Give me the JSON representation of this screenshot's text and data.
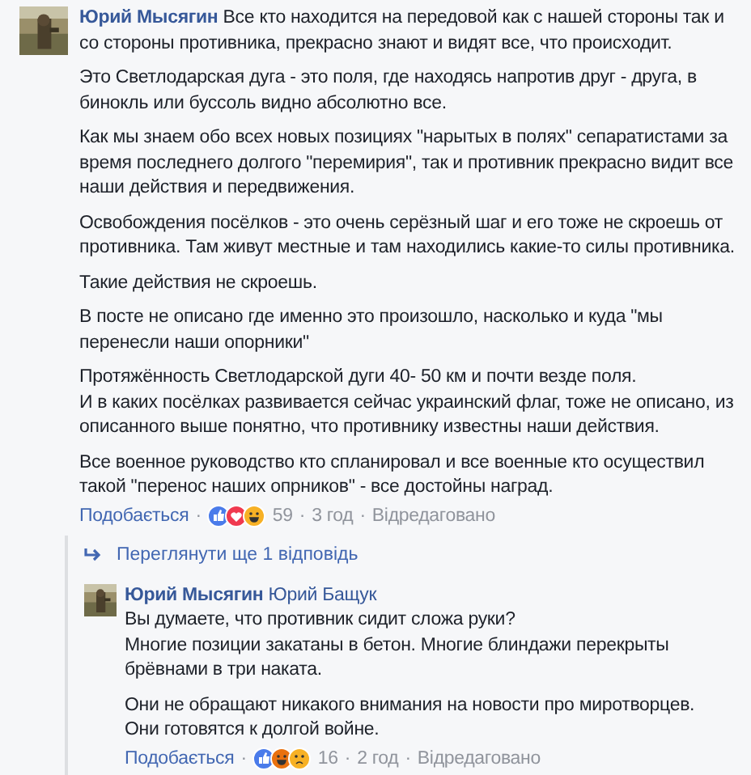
{
  "comment": {
    "author": "Юрий Мысягин",
    "paragraphs": [
      "Все кто находится на передовой как с нашей стороны так и со стороны противника, прекрасно знают и видят все, что происходит.",
      "Это Светлодарская дуга - это поля, где находясь напротив друг - друга, в бинокль или буссоль видно абсолютно все.",
      "Как мы знаем обо всех новых позициях \"нарытых в полях\" сепаратистами за время последнего долгого \"перемирия\", так и противник прекрасно видит все наши действия и передвижения.",
      "Освобождения посёлков - это очень серёзный шаг и его тоже не скроешь от противника. Там живут местные и там находились какие-то силы противника.",
      "Такие действия не скроешь.",
      "В посте не описано где именно это произошло, насколько и куда \"мы перенесли наши опорники\"",
      "Протяжённость Светлодарской дуги 40- 50 км и почти везде поля.\nИ в каких посёлках развивается сейчас украинский флаг, тоже не описано, из описанного выше понятно, что противнику известны наши действия.",
      "Все военное руководство кто спланировал и все военные кто осуществил такой \"перенос наших опрников\" - все достойны наград."
    ],
    "like": "Подобається",
    "separator": "·",
    "reactions": [
      {
        "kind": "like"
      },
      {
        "kind": "love"
      },
      {
        "kind": "haha"
      }
    ],
    "count": "59",
    "time": "3 год",
    "edited": "Відредаговано"
  },
  "more_replies": "Переглянути ще 1 відповідь",
  "reply": {
    "author": "Юрий Мысягин",
    "mention": "Юрий Бащук",
    "paragraphs": [
      "Вы думаете, что противник сидит сложа руки?\nМногие позиции закатаны в бетон. Многие блиндажи перекрыты брёвнами в три наката.",
      "Они не обращают никакого внимания на новости про миротворцев.\nОни готовятся к долгой войне."
    ],
    "like": "Подобається",
    "separator": "·",
    "reactions": [
      {
        "kind": "like"
      },
      {
        "kind": "angry"
      },
      {
        "kind": "sad"
      }
    ],
    "count": "16",
    "time": "2 год",
    "edited": "Відредаговано"
  }
}
